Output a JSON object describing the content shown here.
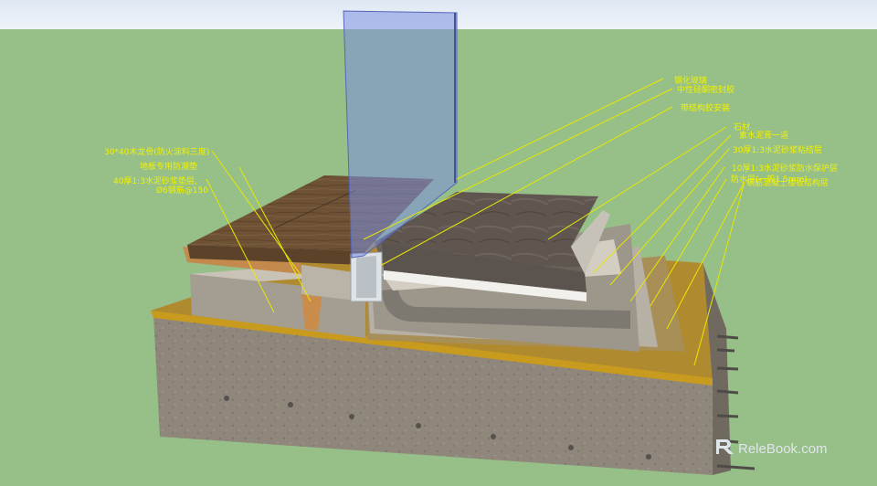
{
  "scene": {
    "sky_color": "#e6edf6",
    "ground_color": "#97bf88",
    "label_color": "#f2f200"
  },
  "labels_right": [
    {
      "text": "钢化玻璃",
      "name": "label-tempered-glass"
    },
    {
      "text": "中性硅酮密封胶",
      "name": "label-silicone-sealant"
    },
    {
      "text": "带结构胶安装",
      "name": "label-structural-adhesive"
    },
    {
      "text": "石材",
      "name": "label-stone"
    },
    {
      "text": "素水泥膏一道",
      "name": "label-cement-paste"
    },
    {
      "text": "30厚1:3水泥砂浆粘结层",
      "name": "label-mortar-bond-layer"
    },
    {
      "text": "10厚1:3水泥砂浆防水保护层",
      "name": "label-waterproof-protection"
    },
    {
      "text": "防水层(一般1.5mm)",
      "name": "label-waterproof-layer"
    },
    {
      "text": "钢筋混凝土楼板结构层",
      "name": "label-concrete-slab"
    }
  ],
  "labels_left": [
    {
      "text": "30*40木龙骨(防火涂料三度)",
      "name": "label-wood-keel"
    },
    {
      "text": "地板专用防潮垫",
      "name": "label-moisture-pad"
    },
    {
      "text": "40厚1:3水泥砂浆垫层,",
      "name": "label-mortar-cushion"
    },
    {
      "text": "Ø6钢筋@150",
      "name": "label-rebar"
    }
  ],
  "watermark": {
    "icon": "relebook-logo-icon",
    "text": "RelеBook.com"
  }
}
